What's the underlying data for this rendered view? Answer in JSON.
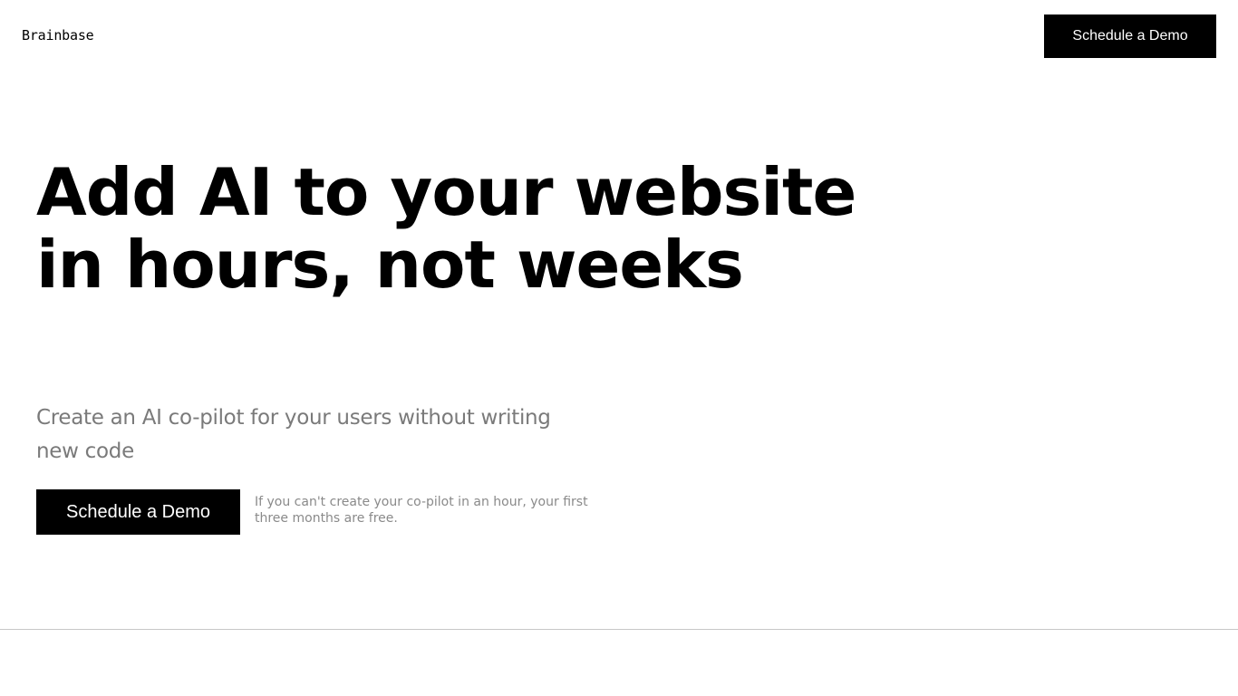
{
  "header": {
    "brand": "Brainbase",
    "cta_label": "Schedule a Demo"
  },
  "hero": {
    "headline": "Add AI to your website in hours, not weeks",
    "subheadline": "Create an AI co-pilot for your users without writing new code",
    "cta_label": "Schedule a Demo",
    "guarantee": "If you can't create your co-pilot in an hour, your first three months are free."
  },
  "colors": {
    "background": "#ffffff",
    "primary": "#000000",
    "muted_text": "#7a7a7a",
    "divider": "#c8c8c8"
  }
}
